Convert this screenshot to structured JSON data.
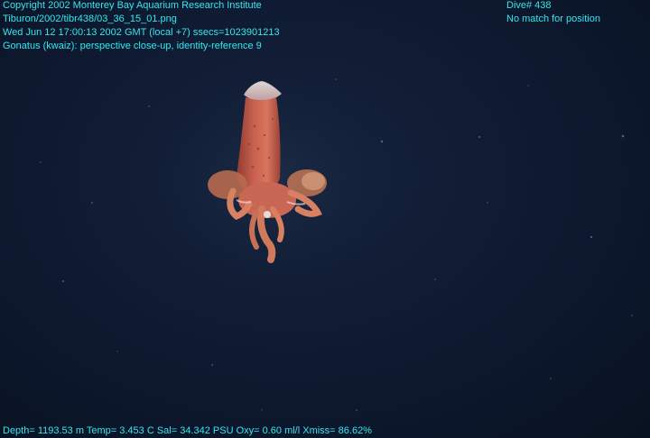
{
  "overlay": {
    "text_color": "#35e6f0",
    "copyright": "Copyright 2002 Monterey Bay Aquarium Research Institute",
    "file_path": "Tiburon/2002/tibr438/03_36_15_01.png",
    "timestamp": "Wed Jun 12 17:00:13 2002 GMT (local +7)  ssecs=1023901213",
    "description": "Gonatus (kwaiz): perspective close-up, identity-reference 9",
    "dive_number": "Dive# 438",
    "position_status": "No match for position",
    "telemetry": "Depth= 1193.53 m  Temp= 3.453 C  Sal= 34.342 PSU  Oxy= 0.60 ml/l  Xmiss= 86.62%"
  },
  "scene": {
    "background_color": "#0f1b32",
    "subject_colors": {
      "mantle": "#c9614e",
      "arms": "#d88062",
      "fin": "#e8dcd8"
    }
  }
}
